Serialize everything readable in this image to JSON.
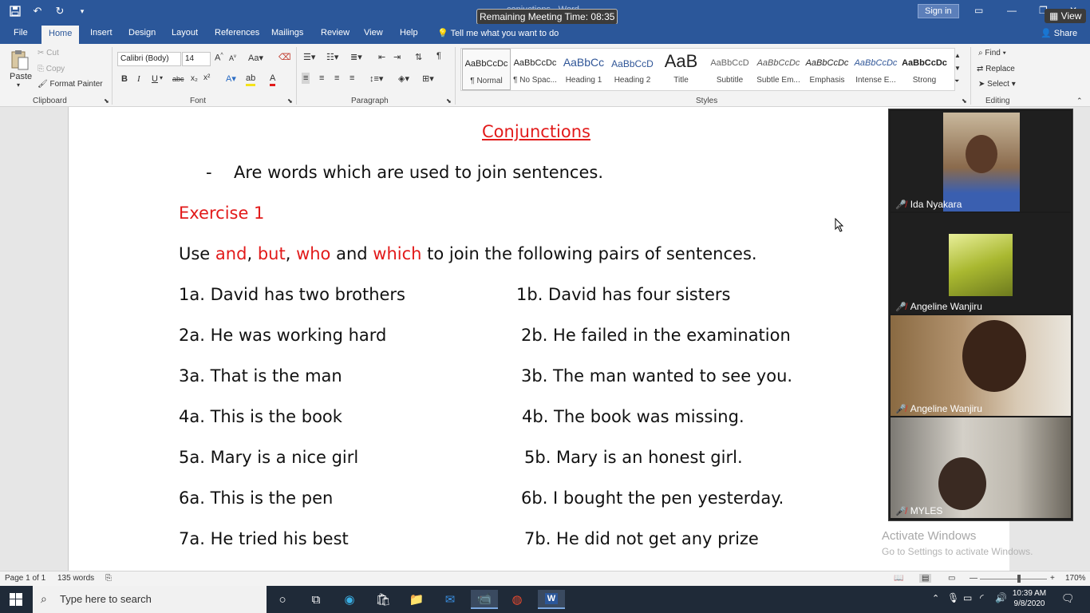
{
  "titlebar": {
    "doc_title": "conjuctions - Word",
    "meeting_time": "Remaining Meeting Time: 08:35",
    "sign_in": "Sign in",
    "view": "View"
  },
  "tabs": [
    "File",
    "Home",
    "Insert",
    "Design",
    "Layout",
    "References",
    "Mailings",
    "Review",
    "View",
    "Help"
  ],
  "tell_me": "Tell me what you want to do",
  "share": "Share",
  "ribbon": {
    "clipboard": {
      "label": "Clipboard",
      "paste": "Paste",
      "cut": "Cut",
      "copy": "Copy",
      "format_painter": "Format Painter"
    },
    "font": {
      "label": "Font",
      "font_name": "Calibri (Body)",
      "font_size": "14"
    },
    "paragraph": {
      "label": "Paragraph"
    },
    "styles": {
      "label": "Styles",
      "items": [
        {
          "sample": "AaBbCcDc",
          "name": "¶ Normal"
        },
        {
          "sample": "AaBbCcDc",
          "name": "¶ No Spac..."
        },
        {
          "sample": "AaBbCc",
          "name": "Heading 1"
        },
        {
          "sample": "AaBbCcD",
          "name": "Heading 2"
        },
        {
          "sample": "AaB",
          "name": "Title"
        },
        {
          "sample": "AaBbCcD",
          "name": "Subtitle"
        },
        {
          "sample": "AaBbCcDc",
          "name": "Subtle Em..."
        },
        {
          "sample": "AaBbCcDc",
          "name": "Emphasis"
        },
        {
          "sample": "AaBbCcDc",
          "name": "Intense E..."
        },
        {
          "sample": "AaBbCcDc",
          "name": "Strong"
        }
      ]
    },
    "editing": {
      "label": "Editing",
      "find": "Find",
      "replace": "Replace",
      "select": "Select"
    }
  },
  "document": {
    "title": "Conjunctions",
    "bullet_dash": "-",
    "definition": "Are words which are used to join sentences.",
    "exercise": "Exercise 1",
    "instruction": {
      "use": "Use",
      "and": "and",
      "comma1": ",",
      "but": "but",
      "comma2": ",",
      "who": "who",
      "and2": "and",
      "which": "which",
      "rest": "to join the following pairs of sentences."
    },
    "pairs": [
      {
        "a": "1a. David has two brothers",
        "b": "1b. David has four sisters"
      },
      {
        "a": "2a. He was working hard",
        "b": "2b. He failed in the examination"
      },
      {
        "a": "3a. That is the man",
        "b": "3b. The man wanted to see you."
      },
      {
        "a": "4a. This is the book",
        "b": "4b. The book was missing."
      },
      {
        "a": "5a. Mary is a nice girl",
        "b": "5b. Mary is an honest girl."
      },
      {
        "a": "6a. This is the pen",
        "b": "6b. I bought the pen yesterday."
      },
      {
        "a": "7a. He tried his best",
        "b": "7b. He did not get any prize"
      }
    ]
  },
  "participants": [
    {
      "name": "Ida Nyakara"
    },
    {
      "name": "Angeline Wanjiru"
    },
    {
      "name": "Angeline Wanjiru"
    },
    {
      "name": "MYLES"
    }
  ],
  "activate": {
    "title": "Activate Windows",
    "subtitle": "Go to Settings to activate Windows."
  },
  "statusbar": {
    "page": "Page 1 of 1",
    "words": "135 words",
    "zoom": "170%"
  },
  "taskbar": {
    "search_placeholder": "Type here to search",
    "time": "10:39 AM",
    "date": "9/8/2020"
  }
}
